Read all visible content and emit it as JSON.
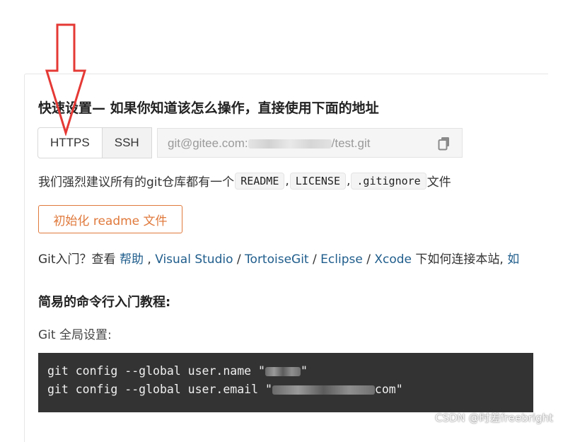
{
  "quick_setup": {
    "title": "快速设置— 如果你知道该怎么操作，直接使用下面的地址",
    "protocols": [
      {
        "label": "HTTPS",
        "selected": true
      },
      {
        "label": "SSH",
        "selected": false
      }
    ],
    "clone_url_prefix": "git@gitee.com:",
    "clone_url_suffix": "/test.git",
    "copy_icon": "copy-icon"
  },
  "recommend": {
    "text_before": "我们强烈建议所有的git仓库都有一个",
    "files": [
      "README",
      "LICENSE",
      ".gitignore"
    ],
    "separator": ",",
    "text_after": "文件"
  },
  "init_button": {
    "label": "初始化 readme 文件"
  },
  "intro": {
    "prefix": "Git入门？查看 ",
    "links": [
      "帮助",
      "Visual Studio",
      "TortoiseGit",
      "Eclipse",
      "Xcode"
    ],
    "sep1": " , ",
    "sep2": " / ",
    "suffix": " 下如何连接本站, ",
    "trailing_link": "如"
  },
  "tutorial": {
    "title": "简易的命令行入门教程:",
    "global_label": "Git 全局设置:",
    "code_lines": [
      {
        "before": "git config --global user.name \"",
        "after": "\""
      },
      {
        "before": "git config --global user.email \"",
        "after": "com\""
      }
    ]
  },
  "watermark": "CSDN @时差freebright",
  "colors": {
    "accent_orange": "#e0793c",
    "link_blue": "#1f5d8c",
    "code_bg": "#333333",
    "annotation_arrow": "#e53935"
  }
}
